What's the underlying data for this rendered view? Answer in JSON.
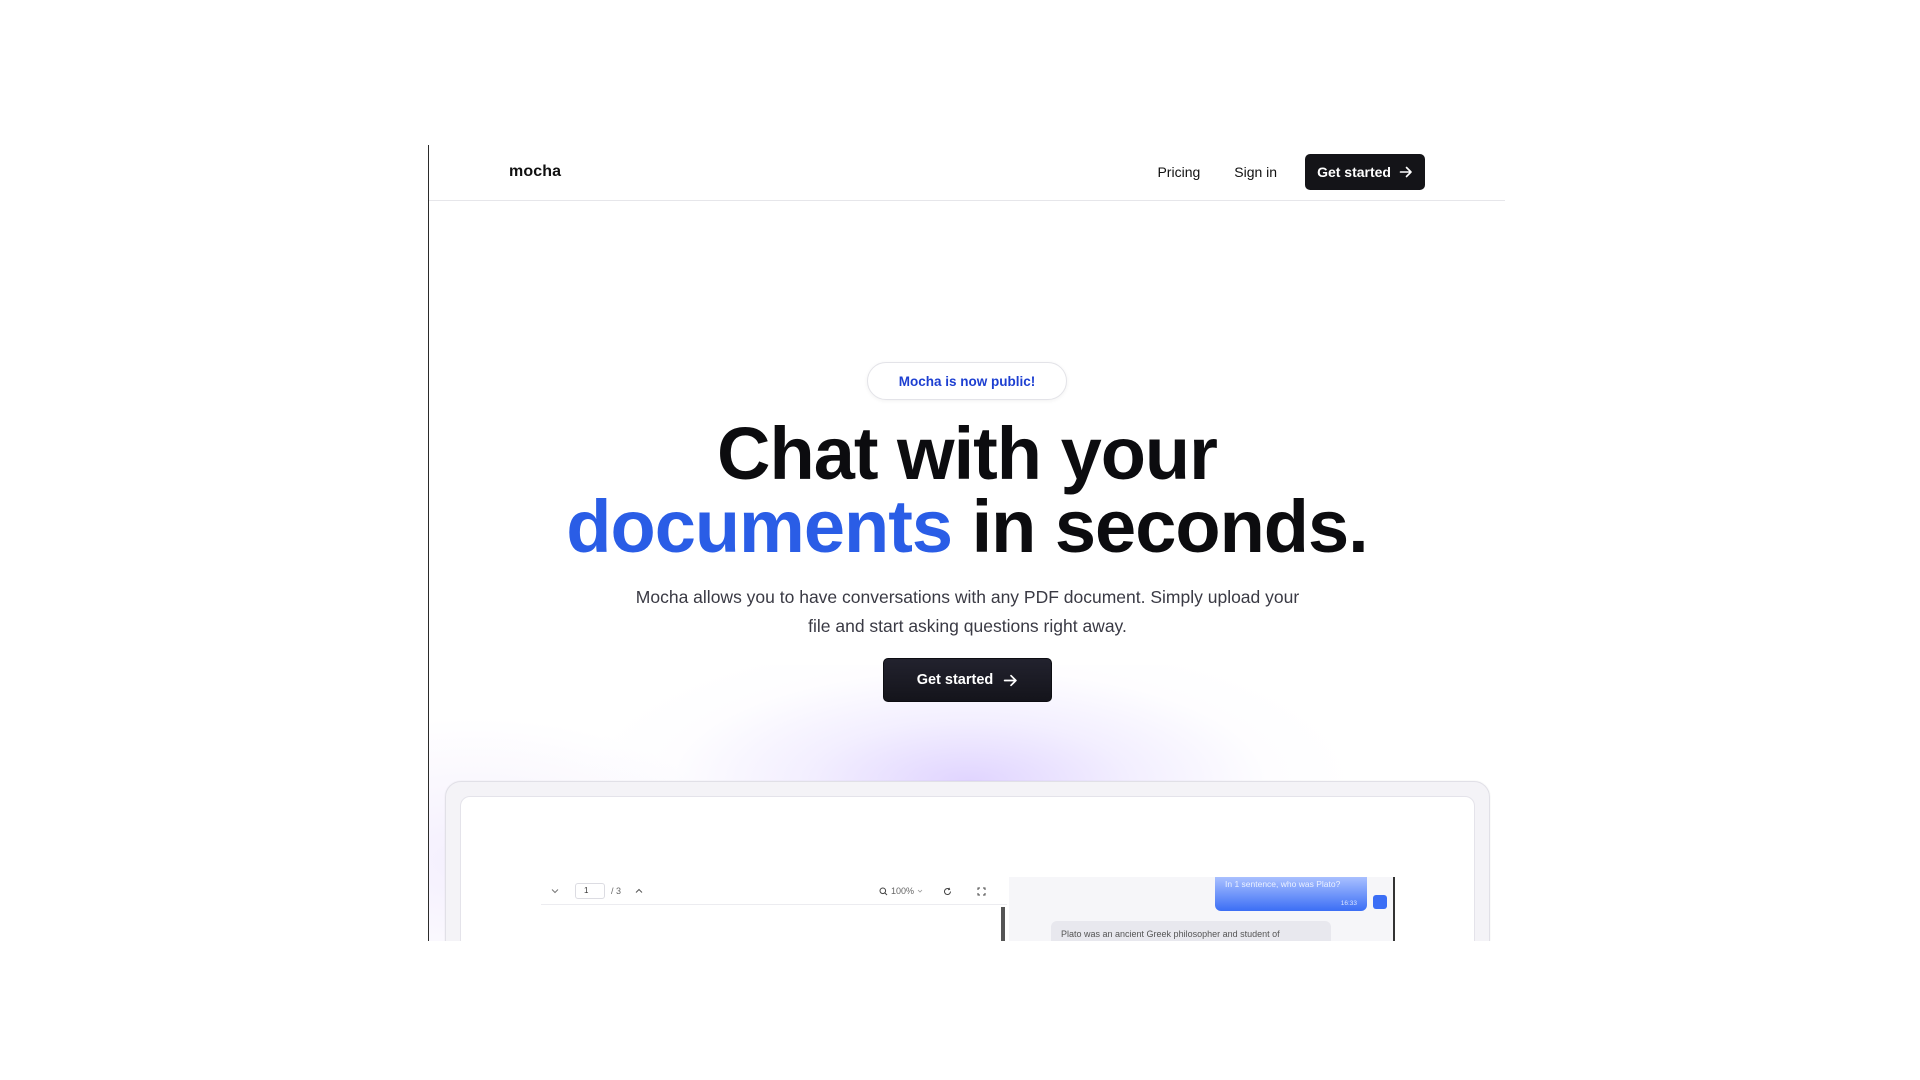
{
  "header": {
    "logo": "mocha",
    "nav": {
      "pricing": "Pricing",
      "sign_in": "Sign in",
      "cta": "Get started"
    }
  },
  "hero": {
    "badge": "Mocha is now public!",
    "title_line1": "Chat with your",
    "title_accent": "documents",
    "title_line2_rest": " in seconds.",
    "subtitle_line1": "Mocha allows you to have conversations with any PDF document. Simply upload your",
    "subtitle_line2": "file and start asking questions right away.",
    "cta": "Get started"
  },
  "preview": {
    "pdf_toolbar": {
      "page_current": "1",
      "page_total": "/ 3",
      "zoom": "100%"
    },
    "chat": {
      "user_message": "In 1 sentence, who was Plato?",
      "user_time": "16:33",
      "bot_message": "Plato was an ancient Greek philosopher and student of"
    }
  },
  "colors": {
    "accent": "#2a5de6",
    "badge_text": "#1d3fd1",
    "cta_bg": "#141418"
  }
}
